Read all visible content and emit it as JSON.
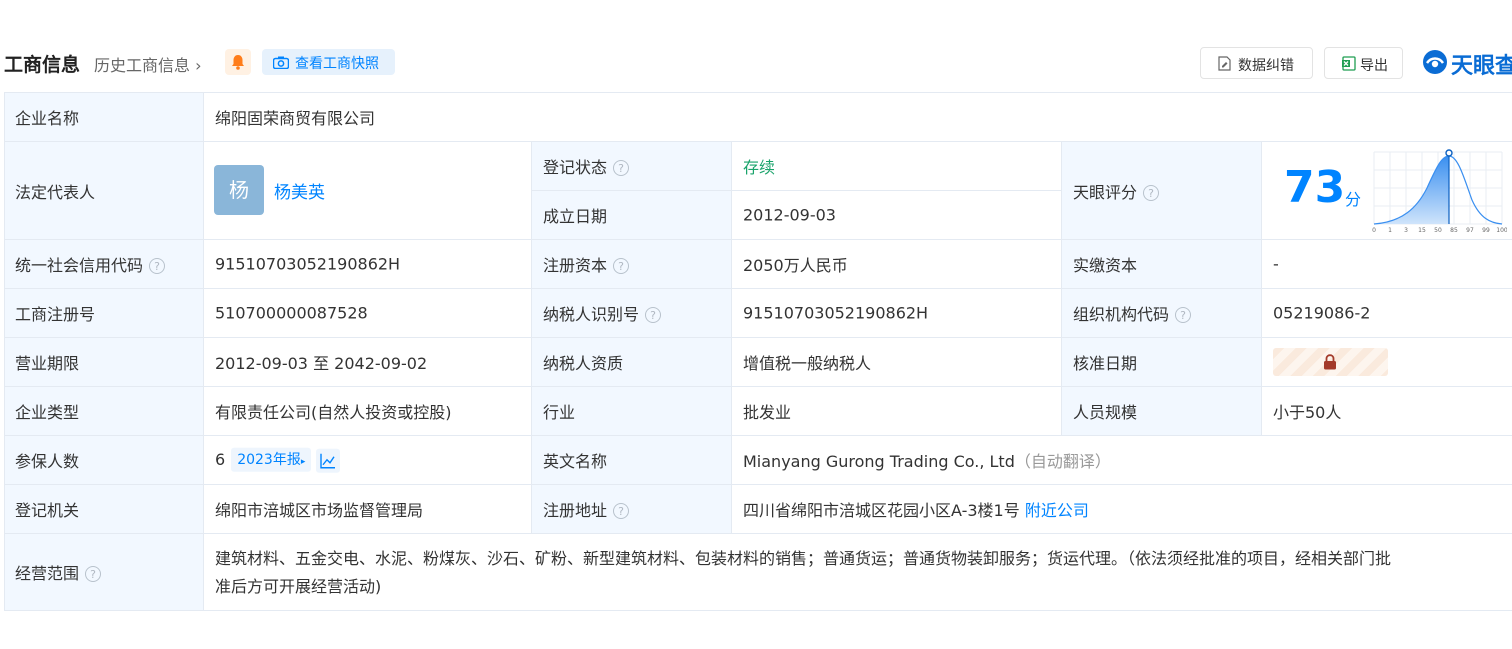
{
  "header": {
    "title": "工商信息",
    "history_link": "历史工商信息",
    "snapshot_button": "查看工商快照",
    "correction_button": "数据纠错",
    "export_button": "导出",
    "brand_logo": "天眼查"
  },
  "fields": {
    "company_name": {
      "label": "企业名称",
      "value": "绵阳固荣商贸有限公司"
    },
    "legal_rep": {
      "label": "法定代表人",
      "avatar_char": "杨",
      "value": "杨美英"
    },
    "reg_status": {
      "label": "登记状态",
      "value": "存续"
    },
    "found_date": {
      "label": "成立日期",
      "value": "2012-09-03"
    },
    "tianyan_score": {
      "label": "天眼评分",
      "score": "73",
      "unit": "分",
      "axis_ticks": [
        "0",
        "1",
        "3",
        "15",
        "50",
        "85",
        "97",
        "99",
        "100"
      ]
    },
    "credit_code": {
      "label": "统一社会信用代码",
      "value": "91510703052190862H"
    },
    "reg_capital": {
      "label": "注册资本",
      "value": "2050万人民币"
    },
    "paid_capital": {
      "label": "实缴资本",
      "value": "-"
    },
    "reg_number": {
      "label": "工商注册号",
      "value": "510700000087528"
    },
    "taxpayer_id": {
      "label": "纳税人识别号",
      "value": "91510703052190862H"
    },
    "org_code": {
      "label": "组织机构代码",
      "value": "05219086-2"
    },
    "business_term": {
      "label": "营业期限",
      "value": "2012-09-03 至 2042-09-02"
    },
    "taxpayer_type": {
      "label": "纳税人资质",
      "value": "增值税一般纳税人"
    },
    "approval_date": {
      "label": "核准日期"
    },
    "company_type": {
      "label": "企业类型",
      "value": "有限责任公司(自然人投资或控股)"
    },
    "industry": {
      "label": "行业",
      "value": "批发业"
    },
    "staff_size": {
      "label": "人员规模",
      "value": "小于50人"
    },
    "insured": {
      "label": "参保人数",
      "value": "6",
      "report_tag": "2023年报"
    },
    "english_name": {
      "label": "英文名称",
      "value": "Mianyang Gurong Trading Co., Ltd",
      "note": "（自动翻译）"
    },
    "reg_authority": {
      "label": "登记机关",
      "value": "绵阳市涪城区市场监督管理局"
    },
    "reg_address": {
      "label": "注册地址",
      "value": "四川省绵阳市涪城区花园小区A-3楼1号",
      "nearby_link": "附近公司"
    },
    "scope": {
      "label": "经营范围",
      "line1": "建筑材料、五金交电、水泥、粉煤灰、沙石、矿粉、新型建筑材料、包装材料的销售；普通货运；普通货物装卸服务；货运代理。（依法须经批准的项目，经相关部门批",
      "line2": "准后方可开展经营活动)"
    }
  },
  "colors": {
    "accent": "#0084ff",
    "label_bg": "#f2f8ff",
    "status_green": "#1aa36b",
    "border": "#e4eaf2"
  }
}
